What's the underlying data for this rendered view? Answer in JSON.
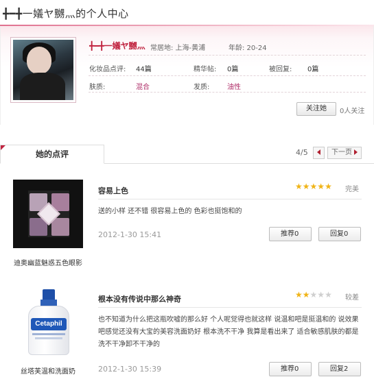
{
  "header": {
    "title": "╋━╋一嬟ヤ嬲灬的个人中心"
  },
  "profile": {
    "username": "╋━╋一嬟ヤ嬲灬",
    "location_label": "常居地: 上海-黄浦",
    "age_label": "年龄: 20-24",
    "stats": [
      {
        "label": "化妆品点评:",
        "value": "44篇"
      },
      {
        "label": "精华帖:",
        "value": "0篇"
      },
      {
        "label": "被回复:",
        "value": "0篇"
      }
    ],
    "skin_label": "肤质:",
    "skin_value": "混合",
    "hair_label": "发质:",
    "hair_value": "油性",
    "follow_button": "关注她",
    "follow_count": "0人关注"
  },
  "reviews_section": {
    "tab_label": "她的点评",
    "pager_text": "4/5",
    "next_label": "下一页"
  },
  "reviews": [
    {
      "product_name": "迪奥幽蓝魅惑五色眼影",
      "title": "容易上色",
      "stars": 5,
      "rating_word": "完美",
      "text": "送的小样 还不错 很容易上色的 色彩也挺饱和的",
      "date": "2012-1-30 15:41",
      "recommend_label": "推荐0",
      "reply_label": "回复0"
    },
    {
      "product_name": "丝塔芙温和洗面奶",
      "title": "根本没有传说中那么神奇",
      "stars": 2,
      "rating_word": "较差",
      "text": "也不知道为什么把这瓶吹嘘的那么好 个人呢觉得也就这样 说温和吧是挺温和的 说效果吧感觉还没有大宝的美容洗面奶好 根本洗不干净 我算是看出来了 适合敏感肌肤的都是洗不干净卸不干净的",
      "date": "2012-1-30 15:39",
      "recommend_label": "推荐0",
      "reply_label": "回复2",
      "brand_text": "Cetaphil"
    }
  ],
  "colors": {
    "accent": "#c0233f",
    "pink_value": "#b0306a",
    "star_on": "#f0b417",
    "star_off": "#cfcfcf"
  }
}
